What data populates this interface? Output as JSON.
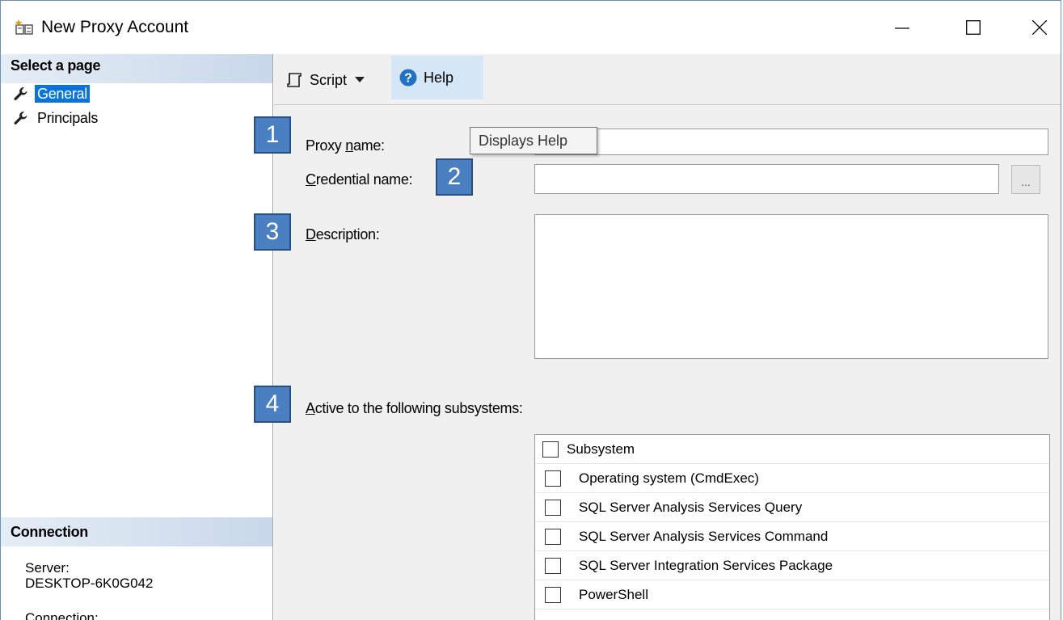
{
  "window": {
    "title": "New Proxy Account",
    "controls": [
      "minimize",
      "maximize",
      "close"
    ]
  },
  "left_pane": {
    "select_page_header": "Select a page",
    "pages": [
      {
        "label": "General",
        "icon": "wrench-icon",
        "selected": true
      },
      {
        "label": "Principals",
        "icon": "wrench-icon",
        "selected": false
      }
    ],
    "connection_header": "Connection",
    "server_label": "Server:",
    "server_value": "DESKTOP-6K0G042",
    "connection_label": "Connection:"
  },
  "toolbar": {
    "script_label": "Script",
    "help_label": "Help",
    "tooltip": "Displays Help"
  },
  "form": {
    "proxy_name": {
      "prefix": "Proxy ",
      "accel": "n",
      "suffix": "ame:",
      "value": ""
    },
    "credential_name": {
      "prefix": "",
      "accel": "C",
      "suffix": "redential name:",
      "value": "",
      "browse_label": "..."
    },
    "description": {
      "prefix": "",
      "accel": "D",
      "suffix": "escription:",
      "value": ""
    },
    "subsystems_label": {
      "prefix": "",
      "accel": "A",
      "suffix": "ctive to the following subsystems:"
    }
  },
  "callouts": [
    "1",
    "2",
    "3",
    "4"
  ],
  "subsystems": {
    "header": "Subsystem",
    "items": [
      {
        "label": "Operating system (CmdExec)",
        "checked": false
      },
      {
        "label": "SQL Server Analysis Services Query",
        "checked": false
      },
      {
        "label": "SQL Server Analysis Services Command",
        "checked": false
      },
      {
        "label": "SQL Server Integration Services Package",
        "checked": false
      },
      {
        "label": "PowerShell",
        "checked": false
      }
    ]
  },
  "colors": {
    "accent": "#0b74d8",
    "callout": "#4a7fc1",
    "help_highlight": "#d5e6f7"
  }
}
